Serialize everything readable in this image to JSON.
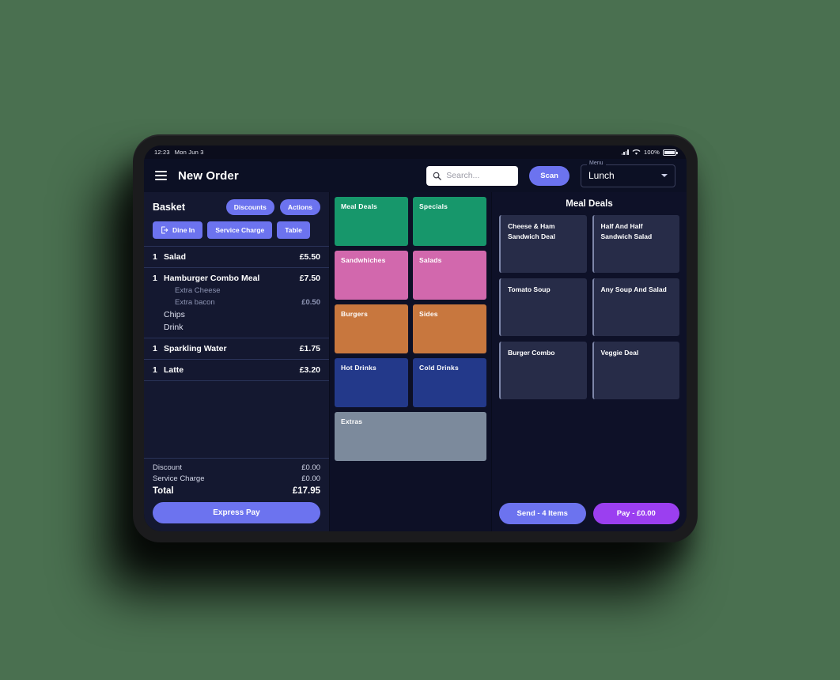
{
  "status_bar": {
    "time": "12:23",
    "date": "Mon Jun 3",
    "battery": "100%"
  },
  "app_bar": {
    "title": "New Order",
    "search_placeholder": "Search...",
    "search_value": "",
    "scan_label": "Scan",
    "menu_legend": "Menu",
    "menu_value": "Lunch"
  },
  "basket": {
    "title": "Basket",
    "discounts_label": "Discounts",
    "actions_label": "Actions",
    "dine_in_label": "Dine In",
    "service_charge_label": "Service Charge",
    "table_label": "Table",
    "items": [
      {
        "qty": "1",
        "name": "Salad",
        "price": "£5.50",
        "modifiers": []
      },
      {
        "qty": "1",
        "name": "Hamburger Combo Meal",
        "price": "£7.50",
        "modifiers": [
          {
            "name": "Extra Cheese",
            "price": "",
            "type": "mod"
          },
          {
            "name": "Extra bacon",
            "price": "£0.50",
            "type": "mod"
          },
          {
            "name": "Chips",
            "price": "",
            "type": "sub"
          },
          {
            "name": "Drink",
            "price": "",
            "type": "sub"
          }
        ]
      },
      {
        "qty": "1",
        "name": "Sparkling Water",
        "price": "£1.75",
        "modifiers": []
      },
      {
        "qty": "1",
        "name": "Latte",
        "price": "£3.20",
        "modifiers": []
      }
    ],
    "discount_label": "Discount",
    "discount_value": "£0.00",
    "service_charge_total_label": "Service Charge",
    "service_charge_total_value": "£0.00",
    "total_label": "Total",
    "total_value": "£17.95",
    "express_pay_label": "Express Pay"
  },
  "categories": [
    {
      "label": "Meal Deals",
      "color": "#17976b",
      "wide": false
    },
    {
      "label": "Specials",
      "color": "#17976b",
      "wide": false
    },
    {
      "label": "Sandwhiches",
      "color": "#d268ad",
      "wide": false
    },
    {
      "label": "Salads",
      "color": "#d268ad",
      "wide": false
    },
    {
      "label": "Burgers",
      "color": "#c8773e",
      "wide": false
    },
    {
      "label": "Sides",
      "color": "#c8773e",
      "wide": false
    },
    {
      "label": "Hot Drinks",
      "color": "#23398a",
      "wide": false
    },
    {
      "label": "Cold Drinks",
      "color": "#23398a",
      "wide": false
    },
    {
      "label": "Extras",
      "color": "#7c8a9c",
      "wide": true
    }
  ],
  "products": {
    "title": "Meal Deals",
    "items": [
      {
        "label": "Cheese & Ham Sandwich Deal"
      },
      {
        "label": "Half And Half Sandwich Salad"
      },
      {
        "label": "Tomato Soup"
      },
      {
        "label": "Any Soup And Salad"
      },
      {
        "label": "Burger Combo"
      },
      {
        "label": "Veggie Deal"
      }
    ],
    "send_label": "Send - 4 Items",
    "pay_label": "Pay - £0.00"
  },
  "colors": {
    "background": "#4a7050",
    "accent": "#6c73ef",
    "pay_accent": "#9b3ff0",
    "basket_panel": "#141830",
    "product_panel": "#0e1128"
  }
}
